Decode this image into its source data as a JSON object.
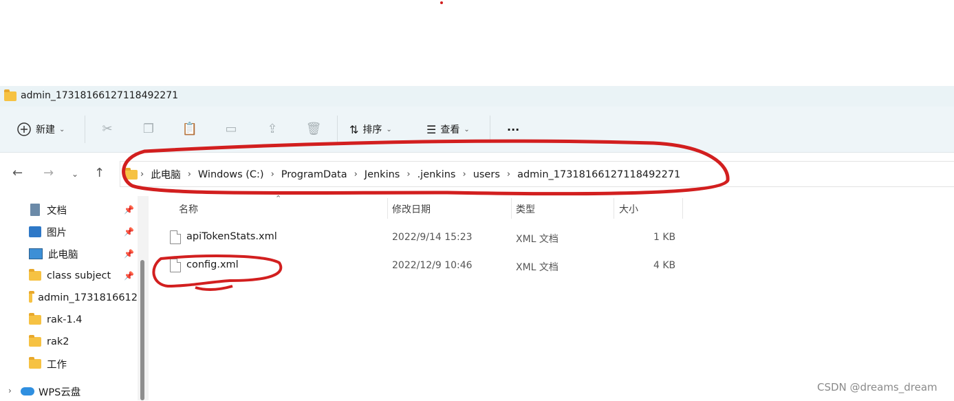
{
  "window": {
    "title": "admin_17318166127118492271"
  },
  "toolbar": {
    "new_label": "新建",
    "sort_label": "排序",
    "view_label": "查看",
    "more_label": "···"
  },
  "address_bar": {
    "crumbs": [
      "此电脑",
      "Windows (C:)",
      "ProgramData",
      "Jenkins",
      ".jenkins",
      "users",
      "admin_17318166127118492271"
    ]
  },
  "sidebar": {
    "items": [
      {
        "label": "文档",
        "icon": "document-icon",
        "pinned": true
      },
      {
        "label": "图片",
        "icon": "image-icon",
        "pinned": true
      },
      {
        "label": "此电脑",
        "icon": "computer-icon",
        "pinned": true
      },
      {
        "label": "class subject",
        "icon": "folder-icon",
        "pinned": true
      },
      {
        "label": "admin_1731816612",
        "icon": "folder-icon",
        "pinned": false
      },
      {
        "label": "rak-1.4",
        "icon": "folder-icon",
        "pinned": false
      },
      {
        "label": "rak2",
        "icon": "folder-icon",
        "pinned": false
      },
      {
        "label": "工作",
        "icon": "folder-icon",
        "pinned": false
      },
      {
        "label": "WPS云盘",
        "icon": "cloud-icon",
        "pinned": false
      }
    ]
  },
  "file_list": {
    "columns": [
      "名称",
      "修改日期",
      "类型",
      "大小"
    ],
    "rows": [
      {
        "name": "apiTokenStats.xml",
        "modified": "2022/9/14 15:23",
        "type": "XML 文档",
        "size": "1 KB"
      },
      {
        "name": "config.xml",
        "modified": "2022/12/9 10:46",
        "type": "XML 文档",
        "size": "4 KB"
      }
    ]
  },
  "watermark": "CSDN @dreams_dream",
  "colors": {
    "annotation_red": "#d21f1f",
    "folder_yellow": "#f6c243",
    "toolbar_bg": "#eef5f8"
  }
}
